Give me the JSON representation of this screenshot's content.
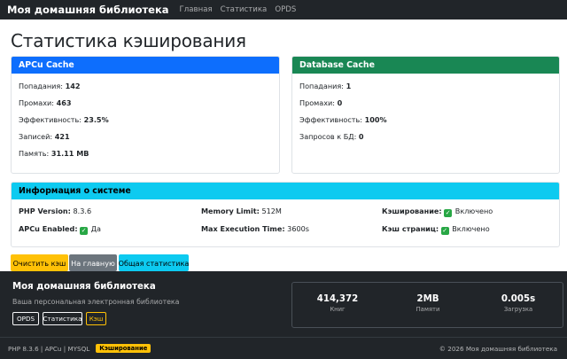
{
  "navbar": {
    "brand": "Моя домашняя библиотека",
    "links": [
      "Главная",
      "Статистика",
      "OPDS"
    ]
  },
  "page": {
    "title": "Статистика кэширования"
  },
  "apcu": {
    "header": "APCu Cache",
    "rows": [
      {
        "label": "Попадания:",
        "value": "142"
      },
      {
        "label": "Промахи:",
        "value": "463"
      },
      {
        "label": "Эффективность:",
        "value": "23.5%"
      },
      {
        "label": "Записей:",
        "value": "421"
      },
      {
        "label": "Память:",
        "value": "31.11 MB"
      }
    ]
  },
  "database": {
    "header": "Database Cache",
    "rows": [
      {
        "label": "Попадания:",
        "value": "1"
      },
      {
        "label": "Промахи:",
        "value": "0"
      },
      {
        "label": "Эффективность:",
        "value": "100%"
      },
      {
        "label": "Запросов к БД:",
        "value": "0"
      }
    ]
  },
  "system": {
    "header": "Информация о системе",
    "items": [
      {
        "label": "PHP Version:",
        "value": "8.3.6",
        "check": false
      },
      {
        "label": "Memory Limit:",
        "value": "512M",
        "check": false
      },
      {
        "label": "Кэширование:",
        "value": "Включено",
        "check": true
      },
      {
        "label": "APCu Enabled:",
        "value": "Да",
        "check": true
      },
      {
        "label": "Max Execution Time:",
        "value": "3600s",
        "check": false
      },
      {
        "label": "Кэш страниц:",
        "value": "Включено",
        "check": true
      }
    ]
  },
  "buttons": {
    "clear": "Очистить кэш",
    "home": "На главную",
    "stats": "Общая статистика"
  },
  "footer": {
    "title": "Моя домашняя библиотека",
    "subtitle": "Ваша персональная электронная библиотека",
    "tags": [
      "OPDS",
      "Статистика",
      "Кэш"
    ],
    "stats": [
      {
        "value": "414,372",
        "label": "Книг"
      },
      {
        "value": "2MB",
        "label": "Памяти"
      },
      {
        "value": "0.005s",
        "label": "Загрузка"
      }
    ]
  },
  "bottom": {
    "left": "PHP 8.3.6 | APCu | MYSQL",
    "badge": "Кэширование",
    "right": "© 2026 Моя домашняя библиотека"
  },
  "colors": {
    "primary": "#0d6efd",
    "success": "#198754",
    "info": "#0dcaf0",
    "warning": "#ffc107",
    "secondary": "#6c757d",
    "dark": "#212529"
  }
}
